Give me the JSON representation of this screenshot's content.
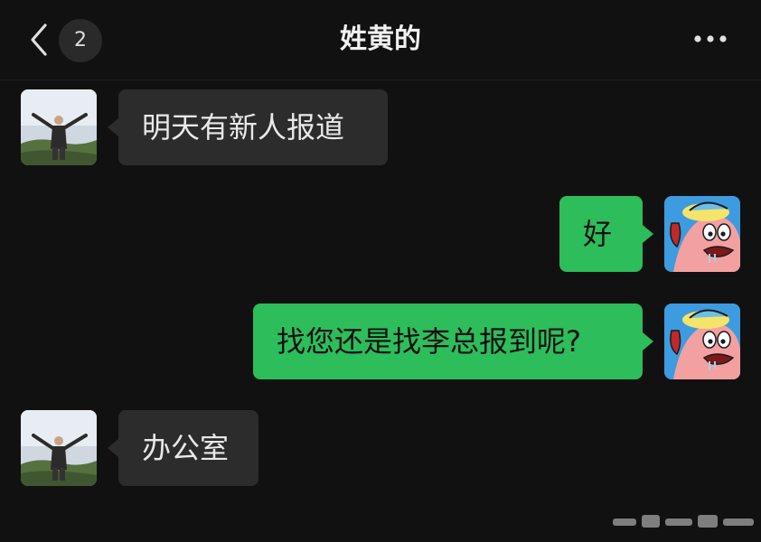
{
  "header": {
    "title": "姓黄的",
    "unread_count": "2",
    "back_icon": "chevron-left-icon",
    "more_icon": "more-dots-icon"
  },
  "messages": [
    {
      "sender": "other",
      "text": "明天有新人报道",
      "avatar": "man-outdoors-avatar"
    },
    {
      "sender": "self",
      "text": "好",
      "avatar": "cartoon-patrick-avatar"
    },
    {
      "sender": "self",
      "text": "找您还是找李总报到呢?",
      "avatar": "cartoon-patrick-avatar"
    },
    {
      "sender": "other",
      "text": "办公室",
      "avatar": "man-outdoors-avatar"
    }
  ],
  "colors": {
    "background": "#111111",
    "incoming_bubble": "#2c2c2c",
    "outgoing_bubble": "#2dbd5b"
  }
}
